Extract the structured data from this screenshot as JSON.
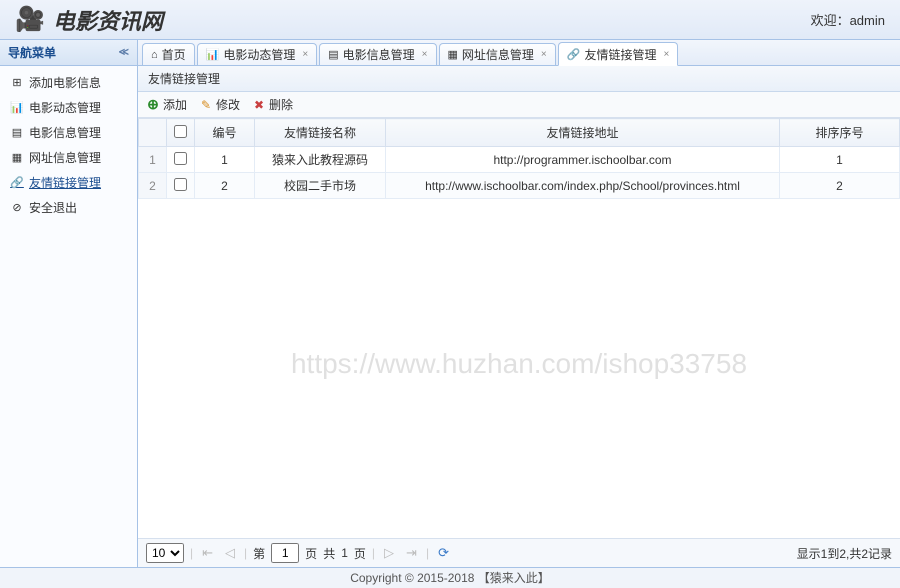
{
  "header": {
    "logo_text": "电影资讯网",
    "welcome_prefix": "欢迎：",
    "username": "admin"
  },
  "sidebar": {
    "title": "导航菜单",
    "items": [
      {
        "icon": "⊞",
        "label": "添加电影信息"
      },
      {
        "icon": "📊",
        "label": "电影动态管理"
      },
      {
        "icon": "▤",
        "label": "电影信息管理"
      },
      {
        "icon": "▦",
        "label": "网址信息管理"
      },
      {
        "icon": "🔗",
        "label": "友情链接管理",
        "active": true
      },
      {
        "icon": "⊘",
        "label": "安全退出"
      }
    ]
  },
  "tabs": [
    {
      "icon": "⌂",
      "label": "首页",
      "closable": false
    },
    {
      "icon": "📊",
      "label": "电影动态管理",
      "closable": true
    },
    {
      "icon": "▤",
      "label": "电影信息管理",
      "closable": true
    },
    {
      "icon": "▦",
      "label": "网址信息管理",
      "closable": true
    },
    {
      "icon": "🔗",
      "label": "友情链接管理",
      "closable": true,
      "active": true
    }
  ],
  "panel": {
    "title": "友情链接管理"
  },
  "toolbar": {
    "add": "添加",
    "edit": "修改",
    "delete": "删除"
  },
  "grid": {
    "columns": [
      "编号",
      "友情链接名称",
      "友情链接地址",
      "排序序号"
    ],
    "rows": [
      {
        "id": "1",
        "name": "猿来入此教程源码",
        "url": "http://programmer.ischoolbar.com",
        "order": "1"
      },
      {
        "id": "2",
        "name": "校园二手市场",
        "url": "http://www.ischoolbar.com/index.php/School/provinces.html",
        "order": "2"
      }
    ]
  },
  "pager": {
    "page_size": "10",
    "page_label_prefix": "第",
    "current_page": "1",
    "page_label_suffix": "页",
    "total_pages_prefix": "共",
    "total_pages": "1",
    "total_pages_suffix": "页",
    "info": "显示1到2,共2记录"
  },
  "footer": {
    "text": "Copyright © 2015-2018 【猿来入此】"
  },
  "watermark": "https://www.huzhan.com/ishop33758"
}
